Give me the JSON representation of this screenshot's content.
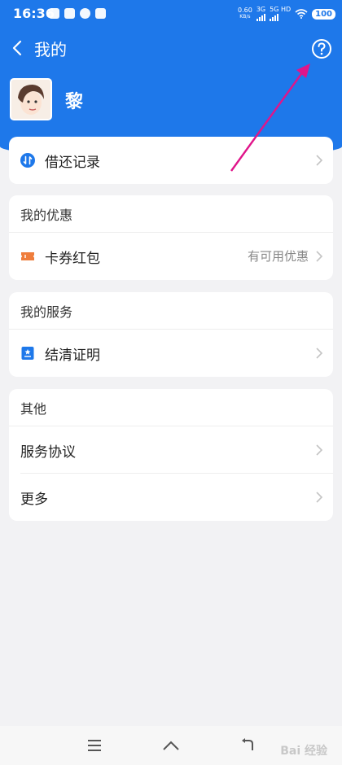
{
  "status_bar": {
    "time": "16:36",
    "net_speed": "0.60",
    "net_unit": "KB/s",
    "sim1": "3G",
    "sim2": "5G HD",
    "battery": "100"
  },
  "header": {
    "title": "我的",
    "username": "黎"
  },
  "loan_card": {
    "label": "借还记录"
  },
  "offers": {
    "section_title": "我的优惠",
    "item_label": "卡券红包",
    "item_hint": "有可用优惠"
  },
  "services": {
    "section_title": "我的服务",
    "item_label": "结清证明"
  },
  "other": {
    "section_title": "其他",
    "items": [
      "服务协议",
      "更多"
    ]
  },
  "watermark": "Bai 经验",
  "colors": {
    "primary": "#1e78ea",
    "coupon_icon": "#ef7d3c",
    "arrow": "#e0158a"
  }
}
